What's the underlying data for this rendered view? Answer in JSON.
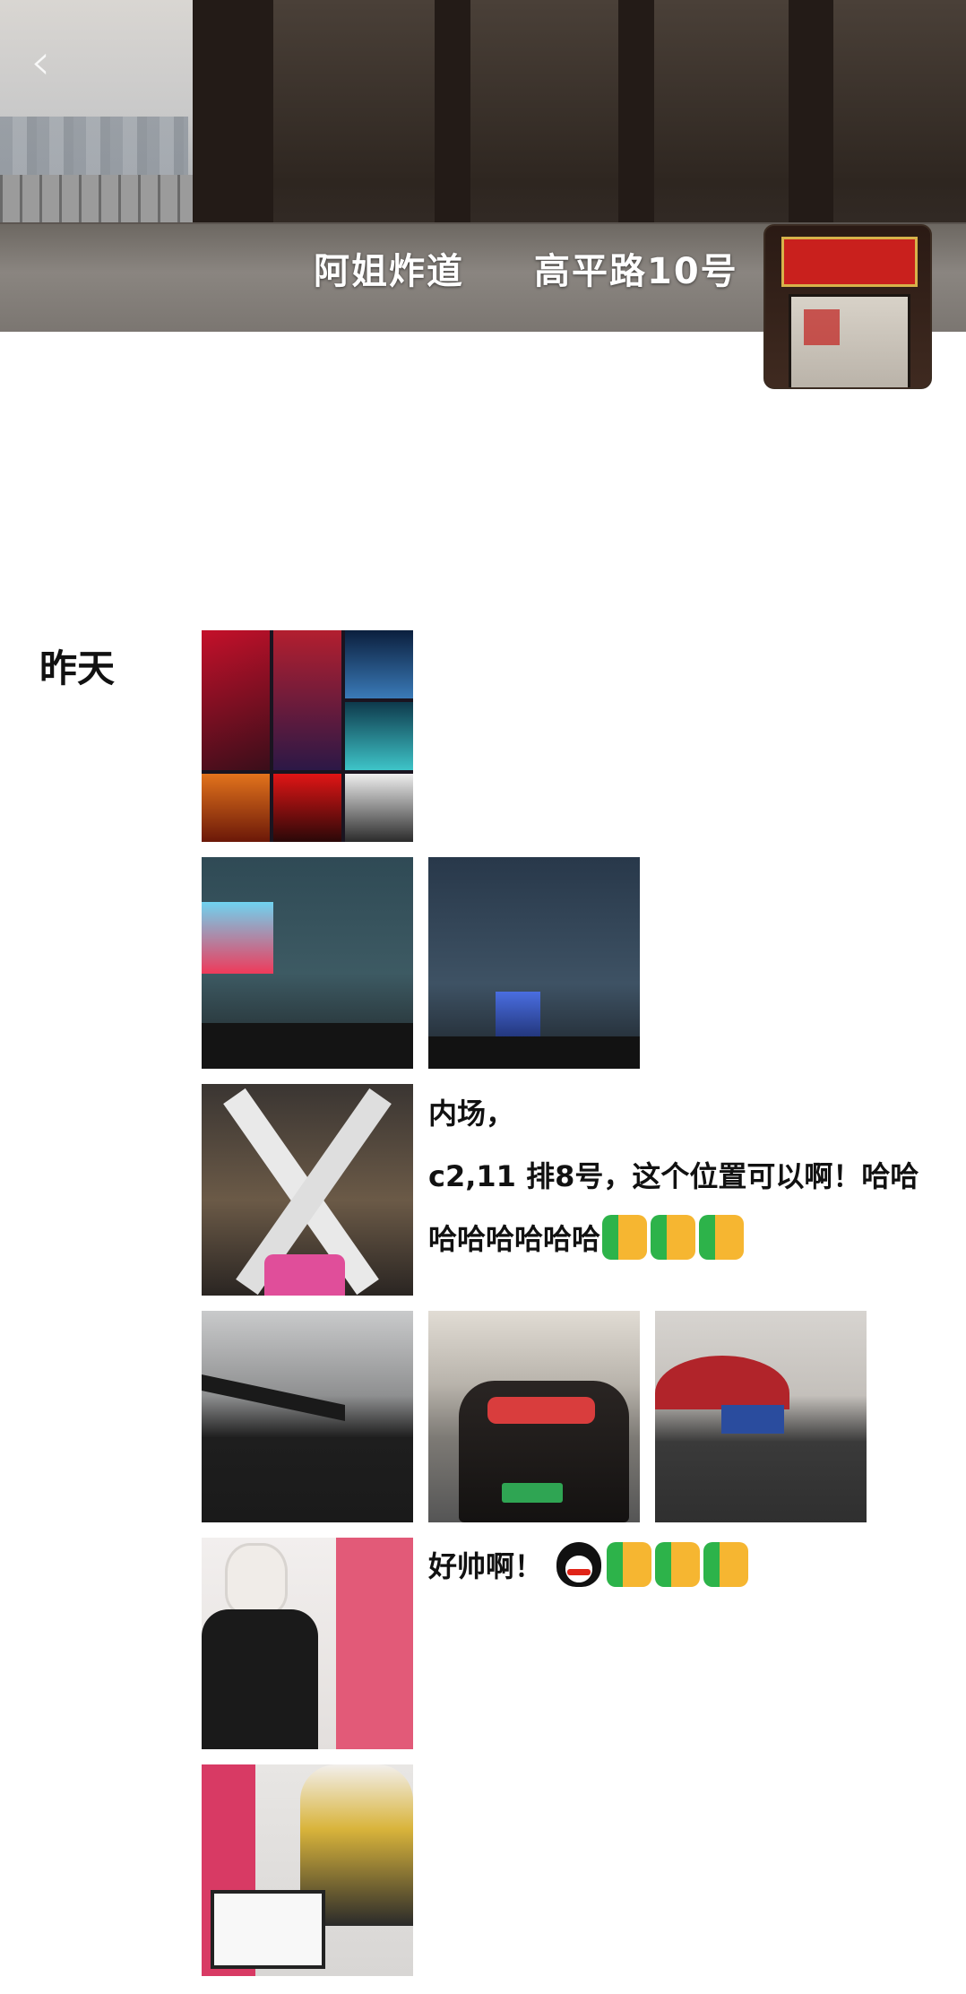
{
  "header": {
    "shop_name": "阿姐炸道",
    "address": "高平路10号"
  },
  "feed": {
    "day_label": "昨天",
    "posts": [
      {
        "id": "post-1",
        "text": "",
        "photos": [
          "collage"
        ]
      },
      {
        "id": "post-2",
        "text": "",
        "photos": [
          "stadium-screen-1",
          "stadium-screen-2"
        ]
      },
      {
        "id": "post-3",
        "text_line1": "内场，",
        "text_line2": "c2,11 排8号，这个位置可以啊！哈哈",
        "text_line3": "哈哈哈哈哈哈",
        "emoji": [
          "thumbs-up",
          "thumbs-up",
          "thumbs-up"
        ]
      },
      {
        "id": "post-4",
        "photos": [
          "stage",
          "car-plate",
          "arena-outside"
        ]
      },
      {
        "id": "post-5",
        "text": "好帅啊！",
        "emoji": [
          "qq-penguin",
          "thumbs-up",
          "thumbs-up",
          "thumbs-up"
        ]
      },
      {
        "id": "post-6",
        "photos": [
          "poster-standee"
        ]
      }
    ]
  },
  "colors": {
    "text": "#111111",
    "background": "#ffffff",
    "thumb_green": "#2db34a",
    "thumb_yellow": "#f6b631"
  }
}
